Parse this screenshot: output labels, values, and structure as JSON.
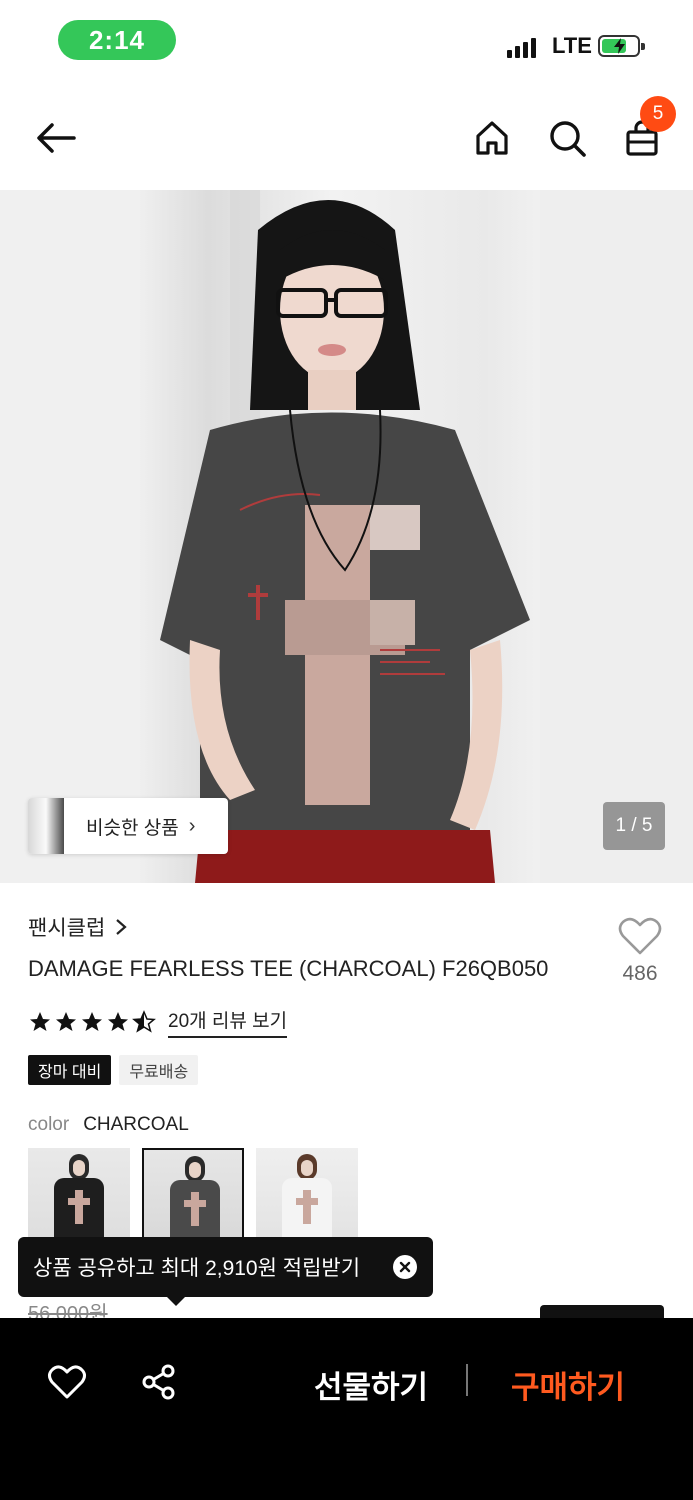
{
  "status": {
    "time": "2:14",
    "network": "LTE"
  },
  "nav": {
    "cart_count": "5"
  },
  "gallery": {
    "similar_label": "비슷한 상품",
    "page_indicator": "1 / 5"
  },
  "product": {
    "brand": "팬시클럽",
    "title": "DAMAGE FEARLESS TEE (CHARCOAL) F26QB050",
    "like_count": "486",
    "rating": 4.5,
    "review_link": "20개 리뷰 보기",
    "tags": [
      "장마 대비",
      "무료배송"
    ],
    "color_label": "color",
    "color_value": "CHARCOAL",
    "swatches": [
      "black",
      "charcoal",
      "white"
    ],
    "old_price": "56,000원"
  },
  "share_tooltip": {
    "text": "상품 공유하고 최대 2,910원 적립받기"
  },
  "bottom_bar": {
    "gift_label": "선물하기",
    "buy_label": "구매하기"
  },
  "colors": {
    "accent": "#ff5a1f",
    "badge": "#ff4b13",
    "status_pill": "#34c759"
  }
}
